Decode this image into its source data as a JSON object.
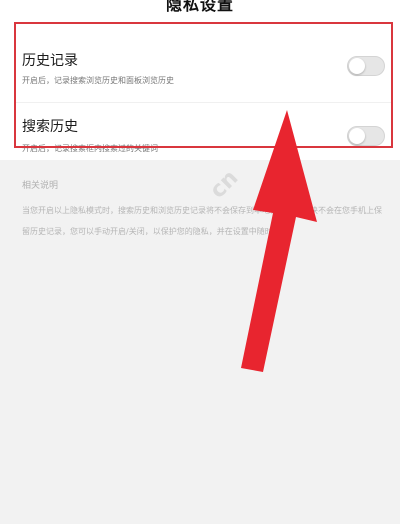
{
  "header": {
    "title": "隐私设置"
  },
  "settings": [
    {
      "title": "历史记录",
      "description": "开启后，记录搜索浏览历史和面板浏览历史",
      "enabled": false
    },
    {
      "title": "搜索历史",
      "description": "开启后，记录搜索框内搜索过的关键词",
      "enabled": false
    }
  ],
  "notes": {
    "heading": "相关说明",
    "body": "当您开启以上隐私模式时，搜索历史和浏览历史记录将不会保存到本地，以及各模块不会在您手机上保留历史记录，您可以手动开启/关闭，以保护您的隐私，并在设置中随时修改。"
  },
  "watermark": "cn",
  "colors": {
    "highlight": "#d9363e",
    "arrow": "#e8252f",
    "toggle_off": "#e6e6e6",
    "background": "#f2f2f2"
  }
}
